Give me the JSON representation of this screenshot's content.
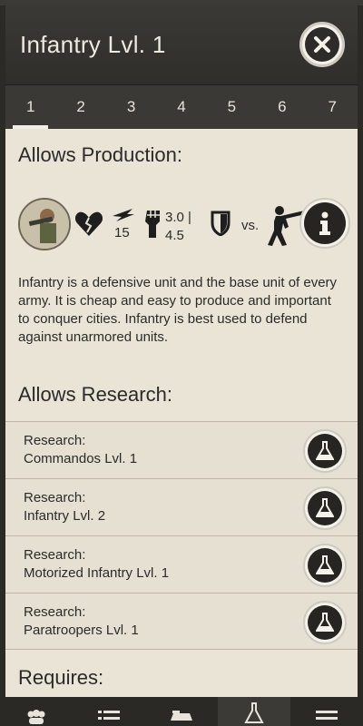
{
  "header": {
    "title": "Infantry Lvl. 1"
  },
  "tabs": [
    "1",
    "2",
    "3",
    "4",
    "5",
    "6",
    "7"
  ],
  "active_tab": "1",
  "production": {
    "title": "Allows Production:",
    "speed": "15",
    "damage": "3.0 |\n4.5",
    "vs_label": "vs.",
    "description": "Infantry is a defensive unit and the base unit of every army. It is cheap and easy to produce and important to conquer cities. Infantry is best used to defend against unarmored units."
  },
  "research": {
    "title": "Allows Research:",
    "items": [
      {
        "label": "Research:",
        "name": "Commandos Lvl. 1"
      },
      {
        "label": "Research:",
        "name": "Infantry Lvl. 2"
      },
      {
        "label": "Research:",
        "name": "Motorized Infantry Lvl. 1"
      },
      {
        "label": "Research:",
        "name": "Paratroopers Lvl. 1"
      }
    ]
  },
  "requires": {
    "title": "Requires:"
  },
  "bottom_nav": [
    "people-icon",
    "list-icon",
    "vehicle-icon",
    "flask-icon",
    "menu-icon"
  ],
  "colors": {
    "panel": "#e9e4d6",
    "dark": "#2f2e2b",
    "accent": "#f1eee6"
  }
}
